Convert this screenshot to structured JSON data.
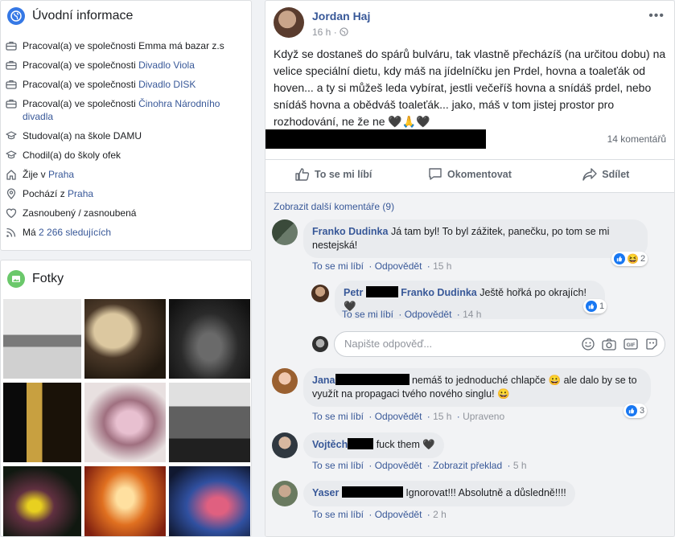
{
  "intro": {
    "title": "Úvodní informace",
    "items": [
      {
        "icon": "briefcase-icon",
        "prefix": "Pracoval(a) ve společnosti Emma má bazar z.s",
        "link": ""
      },
      {
        "icon": "briefcase-icon",
        "prefix": "Pracoval(a) ve společnosti ",
        "link": "Divadlo Viola"
      },
      {
        "icon": "briefcase-icon",
        "prefix": "Pracoval(a) ve společnosti ",
        "link": "Divadlo DISK"
      },
      {
        "icon": "briefcase-icon",
        "prefix": "Pracoval(a) ve společnosti ",
        "link": "Činohra Národního divadla"
      },
      {
        "icon": "graduation-cap-icon",
        "prefix": "Studoval(a) na škole DAMU",
        "link": ""
      },
      {
        "icon": "graduation-cap-icon",
        "prefix": "Chodil(a) do školy ofek",
        "link": ""
      },
      {
        "icon": "home-icon",
        "prefix": "Žije v ",
        "link": "Praha"
      },
      {
        "icon": "location-pin-icon",
        "prefix": "Pochází z ",
        "link": "Praha"
      },
      {
        "icon": "heart-icon",
        "prefix": "Zasnoubený / zasnoubená",
        "link": ""
      },
      {
        "icon": "rss-followers-icon",
        "prefix": "Má ",
        "link": "2 266 sledujících"
      }
    ]
  },
  "photos": {
    "title": "Fotky"
  },
  "post": {
    "author": "Jordan Haj",
    "time": "16 h ·",
    "text": "Když se dostaneš do spárů bulváru, tak vlastně přecházíš (na určitou dobu) na velice speciální dietu, kdy máš na jídelníčku jen Prdel, hovna a toaleťák od hoven... a ty si můžeš leda vybírat, jestli večeříš hovna a snídáš prdel, nebo snídáš hovna a obědváš toaleťák... jako, máš v tom jistej prostor pro rozhodování, ne že ne 🖤🙏🖤",
    "comment_count": "14 komentářů",
    "actions": {
      "like": "To se mi líbí",
      "comment": "Okomentovat",
      "share": "Sdílet"
    },
    "more_comments": "Zobrazit další komentáře (9)"
  },
  "comments": [
    {
      "name": "Franko Dudinka",
      "text": "Já tam byl! To byl zážitek, panečku, po tom se mi nestejská!",
      "like": "To se mi líbí",
      "reply": "Odpovědět",
      "time": "15 h",
      "reactions": "2"
    },
    {
      "name": "Petr ",
      "tag": "Franko Dudinka",
      "text": " Ještě hořká po okrajích! 🖤",
      "like": "To se mi líbí",
      "reply": "Odpovědět",
      "time": "14 h",
      "reactions": "1"
    },
    {
      "name": "Jana",
      "text": " nemáš to jednoduché chlapče 😀 ale dalo by se to využít na propagaci tvého nového singlu! 😀",
      "like": "To se mi líbí",
      "reply": "Odpovědět",
      "time": "15 h",
      "edited": "Upraveno",
      "reactions": "3"
    },
    {
      "name": "Vojtěch",
      "text": " fuck them 🖤",
      "like": "To se mi líbí",
      "reply": "Odpovědět",
      "translate": "Zobrazit překlad",
      "time": "5 h"
    },
    {
      "name": "Yaser",
      "text": " Ignorovat!!! Absolutně a důsledně!!!!",
      "like": "To se mi líbí",
      "reply": "Odpovědět",
      "time": "2 h"
    }
  ],
  "reply_input": {
    "placeholder": "Napište odpověď..."
  },
  "colors": {
    "link": "#385898",
    "like_blue": "#1877f2",
    "bubble": "#e9ebee"
  }
}
